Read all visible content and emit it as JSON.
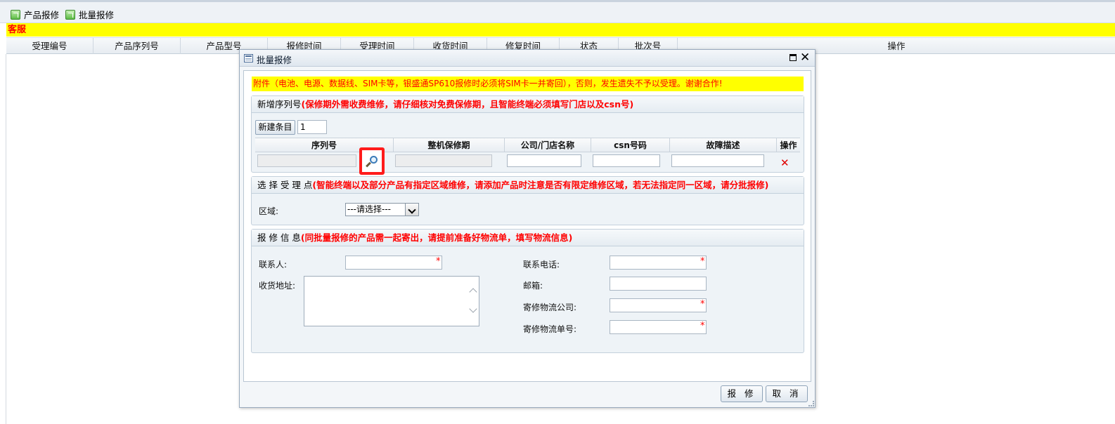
{
  "toolbar": {
    "product_repair_label": "产品报修",
    "batch_repair_label": "批量报修"
  },
  "banner": {
    "text": "客服"
  },
  "grid": {
    "columns": [
      "受理编号",
      "产品序列号",
      "产品型号",
      "报修时间",
      "受理时间",
      "收货时间",
      "修复时间",
      "状态",
      "批次号",
      "操作"
    ]
  },
  "dialog": {
    "title": "批量报修",
    "notice": "附件（电池、电源、数据线、SIM卡等，银盛通SP610报修时必须将SIM卡一并寄回），否则，发生遗失不予以受理。谢谢合作!",
    "serial_section": {
      "title": "新增序列号",
      "note": "(保修期外需收费维修，请仔细核对免费保修期，且智能终端必须填写门店以及csn号)",
      "new_entry_button": "新建条目",
      "count_value": "1",
      "table_headers": [
        "序列号",
        "整机保修期",
        "公司/门店名称",
        "csn号码",
        "故障描述",
        "操作"
      ]
    },
    "acceptance_section": {
      "title": "选 择 受 理 点",
      "note": "(智能终端以及部分产品有指定区域维修，请添加产品时注意是否有限定维修区域，若无法指定同一区域，请分批报修)",
      "region_label": "区域:",
      "region_selected": "---请选择---"
    },
    "repair_info_section": {
      "title": "报 修 信 息",
      "note": "(同批量报修的产品需一起寄出，请提前准备好物流单，填写物流信息)",
      "contact_label": "联系人:",
      "address_label": "收货地址:",
      "phone_label": "联系电话:",
      "email_label": "邮箱:",
      "logistics_company_label": "寄修物流公司:",
      "logistics_number_label": "寄修物流单号:",
      "required_mark": "*"
    },
    "buttons": {
      "submit": "报 修",
      "cancel": "取 消"
    }
  },
  "colors": {
    "banner_bg": "#ffff00",
    "alert_text": "#ff0000",
    "highlight_border": "#ff1b1b",
    "dialog_bg": "#f3f6f9"
  },
  "icons": {
    "toolbar_action": "green-edit-icon",
    "dialog_title": "window-list-icon",
    "search": "magnifier-icon",
    "delete": "red-x-icon",
    "maximize": "maximize-icon",
    "close": "close-icon"
  }
}
